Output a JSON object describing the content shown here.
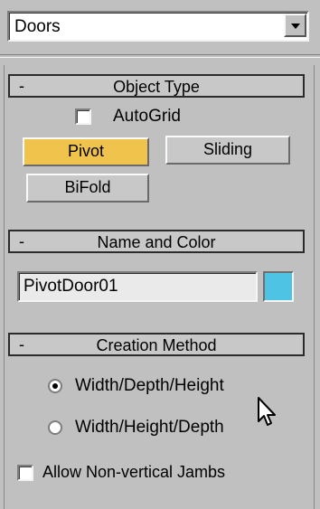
{
  "category_dropdown": {
    "value": "Doors"
  },
  "object_type": {
    "header": "Object Type",
    "collapse_symbol": "-",
    "autogrid_label": "AutoGrid",
    "autogrid_checked": false,
    "buttons": [
      {
        "label": "Pivot",
        "active": true
      },
      {
        "label": "Sliding",
        "active": false
      },
      {
        "label": "BiFold",
        "active": false
      }
    ]
  },
  "name_and_color": {
    "header": "Name and Color",
    "collapse_symbol": "-",
    "name_value": "PivotDoor01",
    "color": "#4fc3e3"
  },
  "creation_method": {
    "header": "Creation Method",
    "collapse_symbol": "-",
    "options": [
      {
        "label": "Width/Depth/Height",
        "selected": true
      },
      {
        "label": "Width/Height/Depth",
        "selected": false
      }
    ],
    "jambs_label": "Allow Non-vertical Jambs",
    "jambs_checked": false
  },
  "colors": {
    "panel_bg": "#c0c0c0",
    "active_button": "#f0c34c"
  },
  "icons": {
    "dropdown_arrow": "chevron-down-icon",
    "cursor": "mouse-pointer-icon"
  }
}
